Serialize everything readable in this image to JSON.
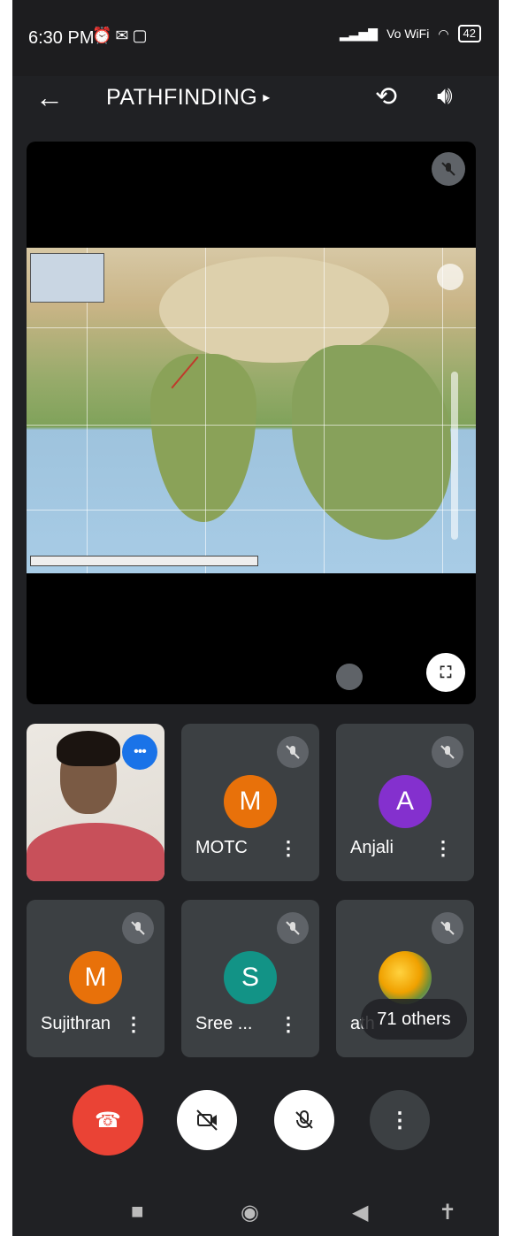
{
  "status_bar": {
    "time": "6:30 PM",
    "left_icons": [
      "alarm-icon",
      "gmail-icon",
      "video-icon"
    ],
    "network": "Vo WiFi",
    "battery": "42"
  },
  "toolbar": {
    "back_icon": "arrow-left-icon",
    "title": "PATHFINDING",
    "title_caret": "▸",
    "camera_switch_icon": "switch-camera-icon",
    "speaker_icon": "speaker-icon"
  },
  "participants": [
    {
      "name": "",
      "initial": "",
      "type": "self-video",
      "speaking": true
    },
    {
      "name": "MOTC",
      "initial": "M",
      "color": "#e8710a"
    },
    {
      "name": "Anjali",
      "initial": "A",
      "color": "#8430ce"
    },
    {
      "name": "Sujithran",
      "initial": "M",
      "color": "#e8710a"
    },
    {
      "name": "Sree ...",
      "initial": "S",
      "color": "#129386"
    },
    {
      "name": "ath",
      "initial": "",
      "type": "photo",
      "others_label": "71 others"
    }
  ],
  "controls": {
    "end_call_icon": "end-call-icon",
    "camera_off_icon": "camera-off-icon",
    "mic_off_icon": "mic-off-icon",
    "more_icon": "more-vertical-icon"
  },
  "colors": {
    "background": "#202124",
    "tile": "#3c4043",
    "end_call": "#ea4335",
    "speaking": "#1a73e8"
  }
}
